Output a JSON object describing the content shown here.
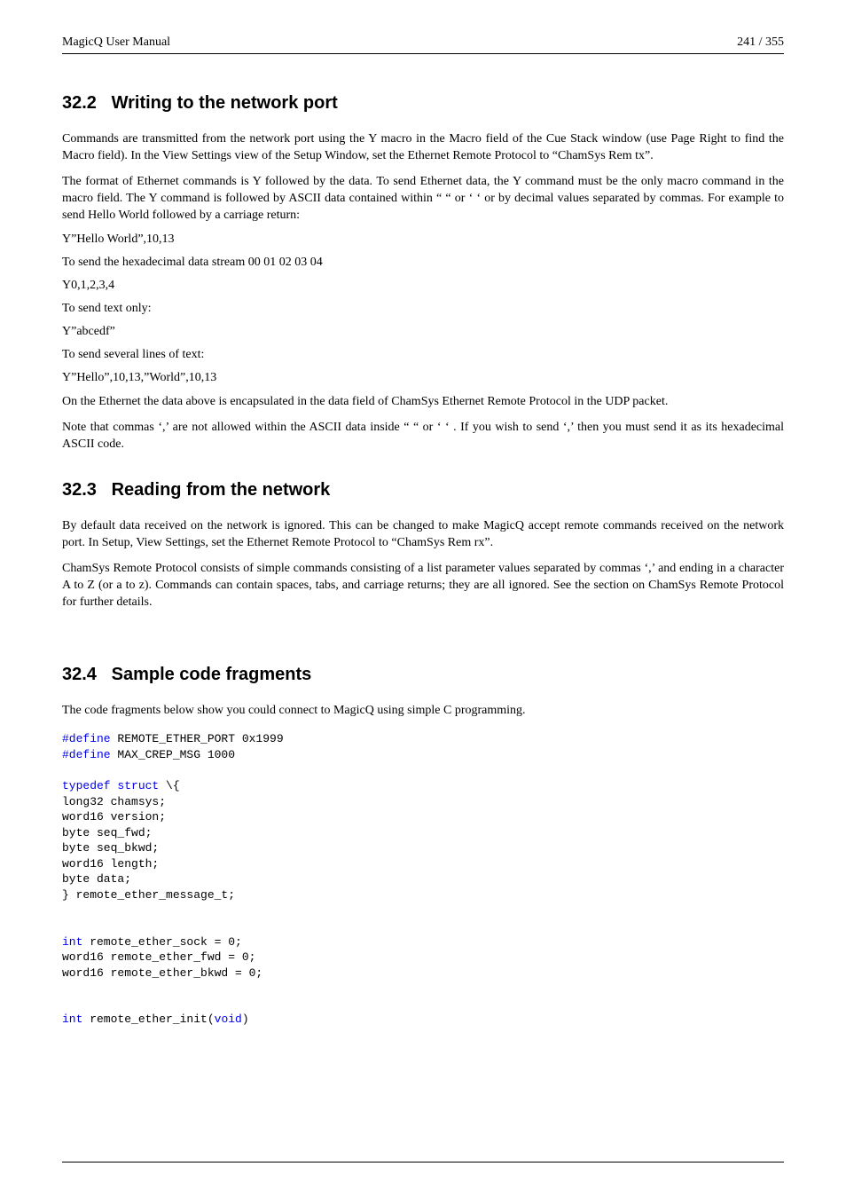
{
  "header": {
    "left": "MagicQ User Manual",
    "right": "241 / 355"
  },
  "s322": {
    "num": "32.2",
    "title": "Writing to the network port",
    "p1": "Commands are transmitted from the network port using the Y macro in the Macro field of the Cue Stack window (use Page Right to find the Macro field). In the View Settings view of the Setup Window, set the Ethernet Remote Protocol to “ChamSys Rem tx”.",
    "p2": "The format of Ethernet commands is Y followed by the data. To send Ethernet data, the Y command must be the only macro command in the macro field. The Y command is followed by ASCII data contained within “ “ or ‘ ‘ or by decimal values separated by commas. For example to send Hello World followed by a carriage return:",
    "l1": "Y”Hello World”,10,13",
    "l2": "To send the hexadecimal data stream 00 01 02 03 04",
    "l3": "Y0,1,2,3,4",
    "l4": "To send text only:",
    "l5": "Y”abcedf”",
    "l6": "To send several lines of text:",
    "l7": "Y”Hello”,10,13,”World”,10,13",
    "l8": "On the Ethernet the data above is encapsulated in the data field of ChamSys Ethernet Remote Protocol in the UDP packet.",
    "l9": "Note that commas ‘,’ are not allowed within the ASCII data inside “ “ or ‘ ‘ . If you wish to send ‘,’ then you must send it as its hexadecimal ASCII code."
  },
  "s323": {
    "num": "32.3",
    "title": "Reading from the network",
    "p1": "By default data received on the network is ignored. This can be changed to make MagicQ accept remote commands received on the network port. In Setup, View Settings, set the Ethernet Remote Protocol to “ChamSys Rem rx”.",
    "p2": "ChamSys Remote Protocol consists of simple commands consisting of a list parameter values separated by commas ‘,’ and ending in a character A to Z (or a to z). Commands can contain spaces, tabs, and carriage returns; they are all ignored. See the section on ChamSys Remote Protocol for further details."
  },
  "s324": {
    "num": "32.4",
    "title": "Sample code fragments",
    "p1": "The code fragments below show you could connect to MagicQ using simple C programming.",
    "code": {
      "c1a": "#define",
      "c1b": " REMOTE_ETHER_PORT 0x1999",
      "c2a": "#define",
      "c2b": " MAX_CREP_MSG 1000",
      "c3a": "typedef struct",
      "c3b": " \\{",
      "c4": "long32 chamsys;",
      "c5": "word16 version;",
      "c6": "byte seq_fwd;",
      "c7": "byte seq_bkwd;",
      "c8": "word16 length;",
      "c9": "byte data;",
      "c10": "} remote_ether_message_t;",
      "c11a": "int",
      "c11b": " remote_ether_sock = 0;",
      "c12": "word16 remote_ether_fwd = 0;",
      "c13": "word16 remote_ether_bkwd = 0;",
      "c14a": "int",
      "c14b": " remote_ether_init(",
      "c14c": "void",
      "c14d": ")"
    }
  }
}
